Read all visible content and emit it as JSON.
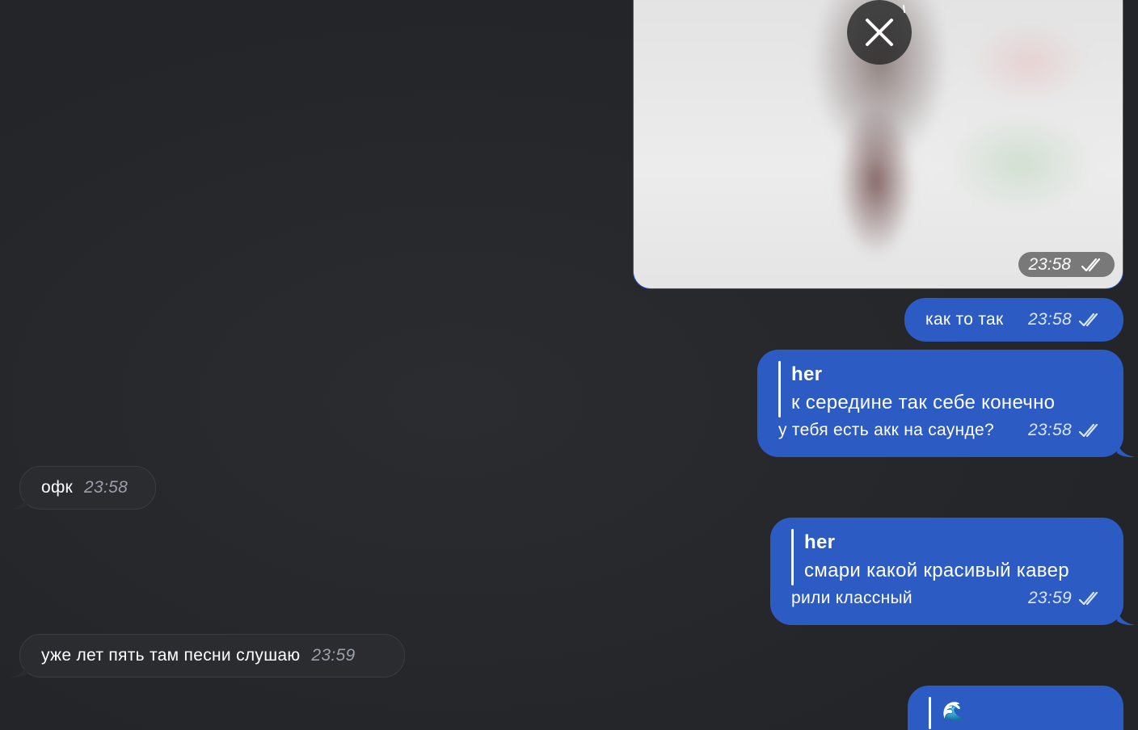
{
  "colors": {
    "background": "#24262a",
    "outgoing_bubble": "#2c5bc4",
    "incoming_bubble": "#2a2c30"
  },
  "image_message": {
    "time": "23:58",
    "status_icon": "double-check-icon",
    "close_icon": "close-icon"
  },
  "messages": [
    {
      "direction": "out",
      "text": "как то так",
      "time": "23:58"
    },
    {
      "direction": "out",
      "reply_author": "her",
      "reply_text": "к середине так себе конечно",
      "text": "у тебя есть акк на саунде?",
      "time": "23:58"
    },
    {
      "direction": "in",
      "text": "офк",
      "time": "23:58"
    },
    {
      "direction": "out",
      "reply_author": "her",
      "reply_text": "смари какой красивый кавер",
      "text": "рили классный",
      "time": "23:59"
    },
    {
      "direction": "in",
      "text": "уже лет пять там песни слушаю",
      "time": "23:59"
    },
    {
      "direction": "out",
      "reply_text": "🌊"
    }
  ]
}
